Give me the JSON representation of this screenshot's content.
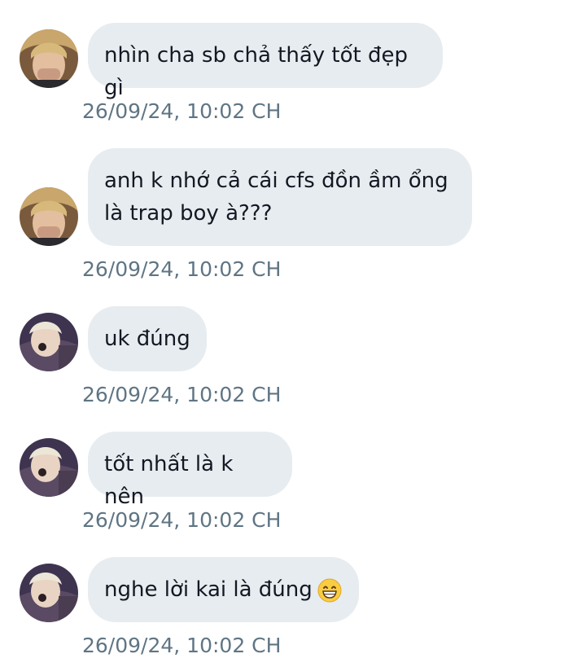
{
  "messages": [
    {
      "sender": "a",
      "text": "nhìn cha sb chả thấy tốt đẹp gì",
      "time": "26/09/24, 10:02 CH"
    },
    {
      "sender": "a",
      "text_line1": "anh k nhớ cả cái cfs đồn ầm ổng",
      "text_line2": "là trap boy à???",
      "time": "26/09/24, 10:02 CH"
    },
    {
      "sender": "b",
      "text": "uk đúng",
      "time": "26/09/24, 10:02 CH"
    },
    {
      "sender": "b",
      "text": "tốt nhất là k nên",
      "time": "26/09/24, 10:02 CH"
    },
    {
      "sender": "b",
      "text": "nghe lời kai là đúng",
      "emoji": "grinning-face-emoji",
      "time": "26/09/24, 10:02 CH"
    }
  ],
  "colors": {
    "bubble_bg": "#e7ecf0",
    "text": "#141823",
    "timestamp": "#5f7584"
  }
}
